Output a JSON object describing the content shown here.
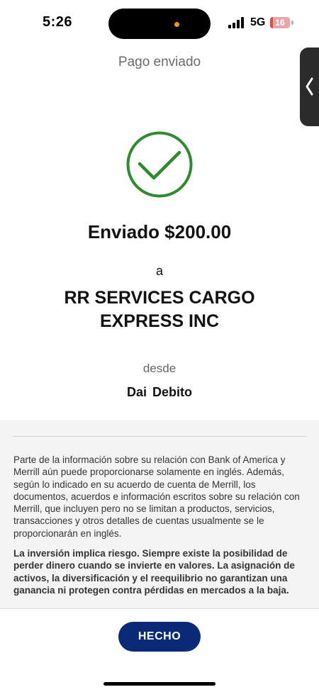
{
  "status_bar": {
    "time": "5:26",
    "network": "5G",
    "battery": "16",
    "battery_level_percent": 16,
    "recording_dot_color": "#f0932b"
  },
  "header": {
    "title": "Pago enviado"
  },
  "side_handle": {
    "icon": "chevron-left-icon"
  },
  "confirmation": {
    "icon": "check-circle-icon",
    "icon_color": "#2e8b2e",
    "amount_text": "Enviado $200.00",
    "to_label": "a",
    "recipient_line1": "RR SERVICES CARGO",
    "recipient_line2": "EXPRESS INC",
    "from_label": "desde",
    "account_name": "Dai Debito"
  },
  "disclosures": {
    "language_notice": "Parte de la información sobre su relación con Bank of America y Merrill aún puede proporcionarse solamente en inglés. Además, según lo indicado en su acuerdo de cuenta de Merrill, los documentos, acuerdos e información escritos sobre su relación con Merrill, que incluyen pero no se limitan a productos, servicios, transacciones y otros detalles de cuentas usualmente se le proporcionarán en inglés.",
    "risk_notice": "La inversión implica riesgo. Siempre existe la posibilidad de perder dinero cuando se invierte en valores. La asignación de activos, la diversificación y el reequilibrio no garantizan una ganancia ni protegen contra pérdidas en mercados a la baja."
  },
  "footer": {
    "done_label": "HECHO",
    "button_color": "#0a2a78"
  }
}
